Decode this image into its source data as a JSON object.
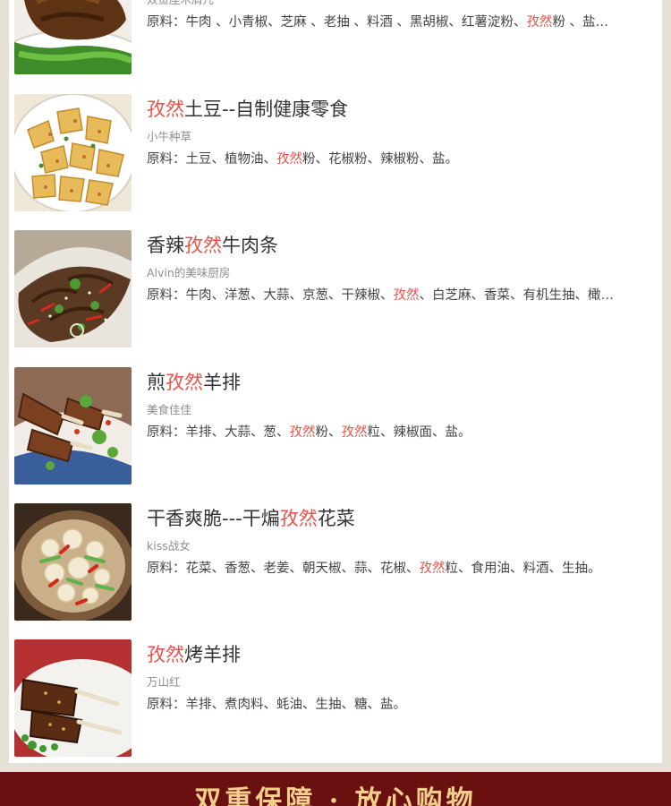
{
  "recipes": [
    {
      "title_parts": [],
      "author": "双鱼座木屑儿",
      "ingredients_parts": [
        "原料：牛肉 、小青椒、芝麻 、老抽 、料酒 、黑胡椒、红薯淀粉、",
        "孜然",
        "粉 、盐…"
      ],
      "image_icon": "dish-photo-beef-green-pepper"
    },
    {
      "title_parts": [
        "孜然",
        "土豆--自制健康零食"
      ],
      "author": "小牛种草",
      "ingredients_parts": [
        "原料：土豆、植物油、",
        "孜然",
        "粉、花椒粉、辣椒粉、盐。"
      ],
      "image_icon": "dish-photo-cumin-potatoes"
    },
    {
      "title_parts": [
        "香辣",
        "孜然",
        "牛肉条"
      ],
      "author": "Alvin的美味厨房",
      "ingredients_parts": [
        "原料：牛肉、洋葱、大蒜、京葱、干辣椒、",
        "孜然",
        "、白芝麻、香菜、有机生抽、橄…"
      ],
      "image_icon": "dish-photo-spicy-beef-strips"
    },
    {
      "title_parts": [
        "煎",
        "孜然",
        "羊排"
      ],
      "author": "美食佳佳",
      "ingredients_parts": [
        "原料：羊排、大蒜、葱、",
        "孜然",
        "粉、",
        "孜然",
        "粒、辣椒面、盐。"
      ],
      "image_icon": "dish-photo-lamb-chops"
    },
    {
      "title_parts": [
        "干香爽脆---干煸",
        "孜然",
        "花菜"
      ],
      "author": "kiss战女",
      "ingredients_parts": [
        "原料：花菜、香葱、老姜、朝天椒、蒜、花椒、",
        "孜然",
        "粒、食用油、料酒、生抽。"
      ],
      "image_icon": "dish-photo-dry-fried-cauliflower"
    },
    {
      "title_parts": [
        "孜然",
        "烤羊排"
      ],
      "author": "万山红",
      "ingredients_parts": [
        "原料：羊排、煮肉料、蚝油、生抽、糖、盐。"
      ],
      "image_icon": "dish-photo-roast-lamb-ribs"
    }
  ],
  "highlight_color": "#e8524a",
  "footer": {
    "text": "双重保障 · 放心购物"
  }
}
